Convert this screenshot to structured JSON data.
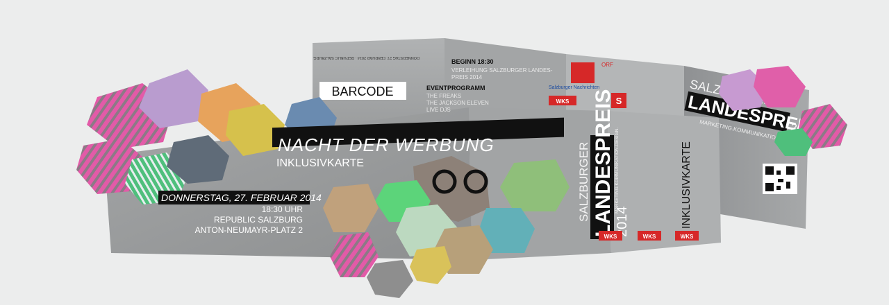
{
  "event": {
    "title": "NACHT DER WERBUNG",
    "ticket_type": "INKLUSIVKARTE",
    "date": "DONNERSTAG, 27. FEBRUAR 2014",
    "time": "18:30 UHR",
    "venue": "REPUBLIC SALZBURG",
    "address": "ANTON-NEUMAYR-PLATZ 2"
  },
  "award": {
    "line1": "SALZBURGER",
    "line2": "LANDESPREIS",
    "year": "2014",
    "tagline": "MARKETING.KOMMUNIKATION.DESIGN."
  },
  "inner": {
    "barcode_label": "BARCODE",
    "program_heading": "EVENTPROGRAMM",
    "program_items": [
      "THE FREAKS",
      "THE JACKSON ELEVEN",
      "LIVE DJS"
    ],
    "begin_heading": "BEGINN 18:30",
    "begin_items": [
      "VERLEIHUNG SALZBURGER LANDES-",
      "PREIS 2014"
    ]
  },
  "sponsors": {
    "news": "Salzburger Nachrichten",
    "orf": "ORF",
    "orf_s": "S",
    "wks": "WKS"
  },
  "colors": {
    "concrete": "#9a9c9d",
    "ink": "#111111",
    "accent_red": "#d62828",
    "pink": "#e04ea3",
    "green": "#4fc06a"
  }
}
